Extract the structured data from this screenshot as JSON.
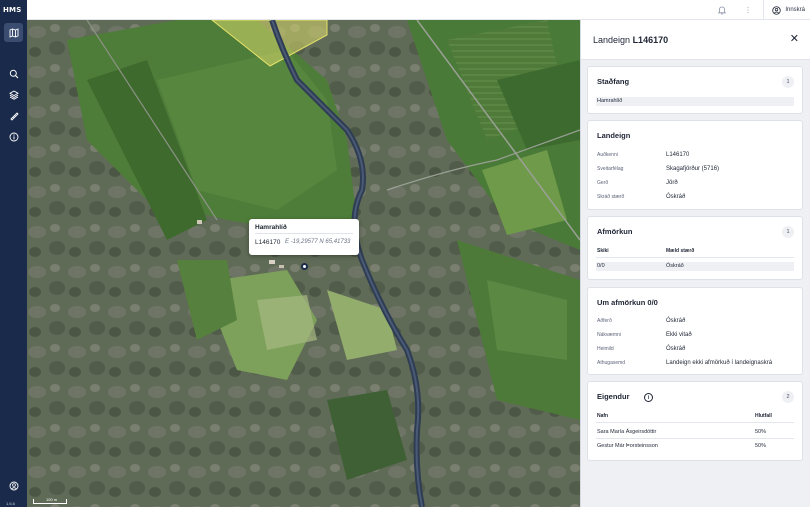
{
  "app": {
    "logo": "HMS",
    "version": "1.6.6"
  },
  "topbar": {
    "login_label": "Innskrá"
  },
  "map": {
    "popup": {
      "title": "Hamrahlíð",
      "id": "L146170",
      "coords": "E -19,29577  N 65,41733"
    },
    "scale_label": "100 m"
  },
  "panel": {
    "title_prefix": "Landeign",
    "title_id": "L146170",
    "stadfang": {
      "heading": "Staðfang",
      "count": "1",
      "value": "Hamrahlíð"
    },
    "landeign": {
      "heading": "Landeign",
      "rows": [
        {
          "label": "Auðkenni",
          "value": "L146170"
        },
        {
          "label": "Sveitarfélag",
          "value": "Skagafjörður (5716)"
        },
        {
          "label": "Gerð",
          "value": "Jörð"
        },
        {
          "label": "Skráð stærð",
          "value": "Óskráð"
        }
      ]
    },
    "afmorkun": {
      "heading": "Afmörkun",
      "count": "1",
      "col1": "Skiki",
      "col2": "Mæld stærð",
      "row": {
        "c1": "0/0",
        "c2": "Óskráð"
      }
    },
    "um_afmorkun": {
      "heading": "Um afmörkun 0/0",
      "rows": [
        {
          "label": "Aðferð",
          "value": "Óskráð"
        },
        {
          "label": "Nákvæmni",
          "value": "Ekki vitað"
        },
        {
          "label": "Heimild",
          "value": "Óskráð"
        },
        {
          "label": "Athugasemd",
          "value": "Landeign ekki afmörkuð í landeignaskrá"
        }
      ]
    },
    "eigendur": {
      "heading": "Eigendur",
      "count": "2",
      "col1": "Nafn",
      "col2": "Hlutfall",
      "rows": [
        {
          "name": "Sara María Ásgeirsdóttir",
          "share": "50%"
        },
        {
          "name": "Gestur Már Þorsteinsson",
          "share": "50%"
        }
      ]
    }
  }
}
